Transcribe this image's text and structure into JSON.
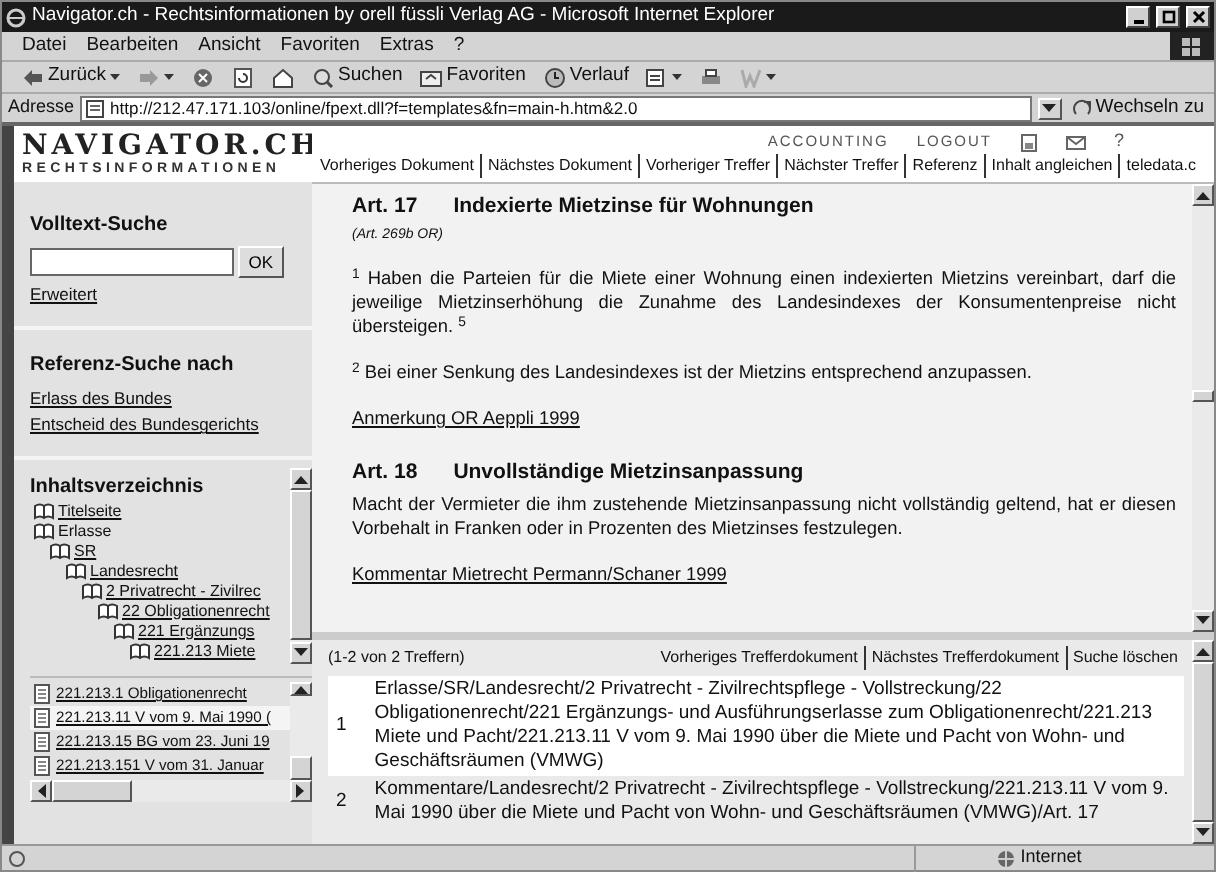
{
  "window": {
    "title": "Navigator.ch - Rechtsinformationen by orell füssli Verlag AG - Microsoft Internet Explorer"
  },
  "menu": [
    "Datei",
    "Bearbeiten",
    "Ansicht",
    "Favoriten",
    "Extras",
    "?"
  ],
  "toolbar": {
    "back": "Zurück",
    "search": "Suchen",
    "favorites": "Favoriten",
    "history": "Verlauf"
  },
  "address": {
    "label": "Adresse",
    "value": "http://212.47.171.103/online/fpext.dll?f=templates&fn=main-h.htm&2.0",
    "go": "Wechseln zu"
  },
  "header": {
    "logo": "NAVIGATOR.CH",
    "tagline": "RECHTSINFORMATIONEN",
    "links": [
      "ACCOUNTING",
      "LOGOUT"
    ],
    "help": "?",
    "nav": [
      "Vorheriges Dokument",
      "Nächstes Dokument",
      "Vorheriger Treffer",
      "Nächster Treffer",
      "Referenz",
      "Inhalt angleichen",
      "teledata.c"
    ]
  },
  "sidebar": {
    "search_title": "Volltext-Suche",
    "search_button": "OK",
    "advanced": "Erweitert",
    "reference_title": "Referenz-Suche nach",
    "reference_links": [
      "Erlass des Bundes",
      "Entscheid des Bundesgerichts"
    ],
    "toc_title": "Inhaltsverzeichnis",
    "tree": [
      {
        "label": "Titelseite",
        "link": true
      },
      {
        "label": "Erlasse",
        "link": false,
        "children": [
          {
            "label": "SR",
            "link": true,
            "children": [
              {
                "label": "Landesrecht",
                "link": true,
                "children": [
                  {
                    "label": "2 Privatrecht - Zivilrec",
                    "link": true,
                    "children": [
                      {
                        "label": "22 Obligationenrecht",
                        "link": true,
                        "children": [
                          {
                            "label": "221 Ergänzungs",
                            "link": true,
                            "children": [
                              {
                                "label": "221.213 Miete",
                                "link": true
                              }
                            ]
                          }
                        ]
                      }
                    ]
                  }
                ]
              }
            ]
          }
        ]
      }
    ],
    "documents": [
      {
        "label": "221.213.1 Obligationenrecht",
        "selected": false
      },
      {
        "label": "221.213.11 V vom 9. Mai 1990 (",
        "selected": true
      },
      {
        "label": "221.213.15 BG vom 23. Juni 19",
        "selected": false
      },
      {
        "label": "221.213.151 V vom 31. Januar",
        "selected": false
      }
    ]
  },
  "document": [
    {
      "kind": "heading",
      "number": "Art. 17",
      "title": "Indexierte Mietzinse für Wohnungen"
    },
    {
      "kind": "source",
      "text": "(Art. 269b OR)"
    },
    {
      "kind": "paragraph",
      "text": "$^{1}$ Haben die Parteien für die Miete einer Wohnung einen indexierten Mietzins vereinbart, darf die jeweilige Mietzinserhöhung die Zunahme des Landesindexes der Konsumentenpreise nicht übersteigen. $^{5}$"
    },
    {
      "kind": "paragraph",
      "text": "$^{2}$ Bei einer Senkung des Landesindexes ist der Mietzins entsprechend anzupassen."
    },
    {
      "kind": "link",
      "text": "Anmerkung OR Aeppli 1999"
    },
    {
      "kind": "heading",
      "number": "Art. 18",
      "title": "Unvollständige Mietzinsanpassung"
    },
    {
      "kind": "paragraph",
      "text": "Macht der Vermieter die ihm zustehende Mietzinsanpassung nicht vollständig geltend, hat er diesen Vorbehalt in Franken oder in Prozenten des Mietzinses festzulegen."
    },
    {
      "kind": "link",
      "text": "Kommentar Mietrecht Permann/Schaner 1999"
    }
  ],
  "results": {
    "count": "(1-2 von 2 Treffern)",
    "links": [
      "Vorheriges Trefferdokument",
      "Nächstes Trefferdokument",
      "Suche löschen"
    ],
    "rows": [
      {
        "number": "1",
        "text": "Erlasse/SR/Landesrecht/2 Privatrecht - Zivilrechtspflege - Vollstreckung/22 Obligationenrecht/221 Ergänzungs- und Ausführungserlasse zum Obligationenrecht/221.213 Miete und Pacht/221.213.11 V vom 9. Mai 1990 über die Miete und Pacht von Wohn- und Geschäftsräumen (VMWG)",
        "selected": true
      },
      {
        "number": "2",
        "text": "Kommentare/Landesrecht/2 Privatrecht - Zivilrechtspflege - Vollstreckung/221.213.11 V vom 9. Mai 1990 über die Miete und Pacht von Wohn- und Geschäftsräumen (VMWG)/Art. 17",
        "selected": false
      }
    ]
  },
  "status_bar": {
    "zone": "Internet"
  }
}
